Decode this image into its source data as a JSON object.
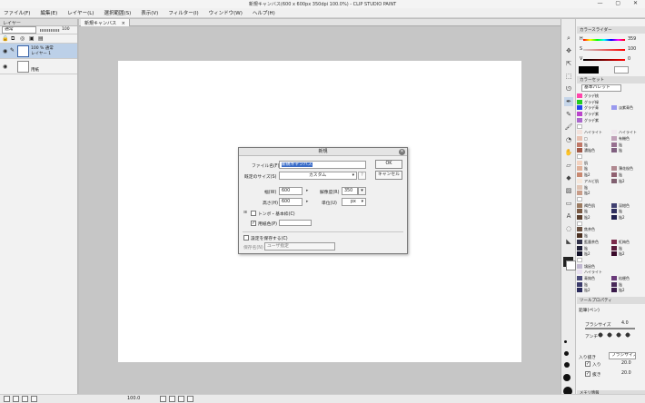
{
  "window": {
    "title": "新規キャンバス(600 x 600px 350dpi 100.0%) - CLIP STUDIO PAINT",
    "controls": "— ▢ ✕"
  },
  "menu": [
    "ファイル(F)",
    "編集(E)",
    "レイヤー(L)",
    "選択範囲(S)",
    "表示(V)",
    "フィルター(I)",
    "ウィンドウ(W)",
    "ヘルプ(H)"
  ],
  "layer_panel": {
    "title": "レイヤー",
    "blend_mode": "通常",
    "opacity": "100",
    "layers": [
      {
        "line1": "100 % 通常",
        "line2": "レイヤー 1"
      },
      {
        "line1": "",
        "line2": "用紙"
      }
    ]
  },
  "canvas": {
    "tab_label": "新規キャンバス"
  },
  "dialog": {
    "title": "新規",
    "close": "✕",
    "file_name_label": "ファイル名(F)",
    "file_name_value": "新規キャンバス",
    "preset_label": "既定のサイズ(S)",
    "preset_value": "カスタム",
    "width_label": "幅(W)",
    "width_value": "600",
    "height_label": "高さ(H)",
    "height_value": "600",
    "resolution_label": "解像度(R)",
    "resolution_value": "350",
    "unit_label": "単位(U)",
    "unit_value": "px",
    "crop_label": "トンボ・基本枠(C)",
    "paper_color_label": "用紙色(P)",
    "save_settings_label": "設定を保存する(C)",
    "save_name_label": "保存名(N)",
    "save_name_value": "ユーザ指定",
    "ok": "OK",
    "cancel": "キャンセル",
    "paper_color": "#ffffff"
  },
  "color_slider": {
    "title": "カラースライダー",
    "h_label": "H",
    "h_value": "359",
    "s_label": "S",
    "s_value": "100",
    "v_label": "V",
    "v_value": "0"
  },
  "color_set": {
    "title": "カラーセット",
    "preset": "基本パレット",
    "swatches": [
      {
        "c1": "#ff44aa",
        "l1": "グラデ桃",
        "c2": "",
        "l2": ""
      },
      {
        "c1": "#22cc22",
        "l1": "グラデ緑",
        "c2": "",
        "l2": ""
      },
      {
        "c1": "#2244ee",
        "l1": "グラデ青",
        "c2": "#9999ee",
        "l2": "淡紫青色"
      },
      {
        "c1": "#bb44cc",
        "l1": "グラデ紫",
        "c2": "",
        "l2": ""
      },
      {
        "c1": "#aa66cc",
        "l1": "グラデ紫",
        "c2": "",
        "l2": ""
      },
      {
        "c1": "#ffffff",
        "l1": "",
        "c2": "",
        "l2": ""
      },
      {
        "c1": "#f2e2dc",
        "l1": "ハイライト",
        "c2": "#f0e8ee",
        "l2": "ハイライト"
      },
      {
        "c1": "#e8c0b0",
        "l1": "□",
        "c2": "#c0a0b8",
        "l2": "有機色"
      },
      {
        "c1": "#c07868",
        "l1": "陰",
        "c2": "#987090",
        "l2": "陰"
      },
      {
        "c1": "#a05848",
        "l1": "濃陰色",
        "c2": "#806080",
        "l2": "陰"
      },
      {
        "c1": "#ffffff",
        "l1": "",
        "c2": "",
        "l2": ""
      },
      {
        "c1": "#f2d2c0",
        "l1": "肌",
        "c2": "",
        "l2": ""
      },
      {
        "c1": "#e0b098",
        "l1": "陰",
        "c2": "#b08890",
        "l2": "薄花桜色"
      },
      {
        "c1": "#c88870",
        "l1": "陰2",
        "c2": "#906070",
        "l2": "陰"
      },
      {
        "c1": "#f6e8dc",
        "l1": "アルビ肌",
        "c2": "#806070",
        "l2": "陰2"
      },
      {
        "c1": "#e0c4b4",
        "l1": "陰",
        "c2": "",
        "l2": ""
      },
      {
        "c1": "#c89c88",
        "l1": "陰2",
        "c2": "",
        "l2": ""
      },
      {
        "c1": "#ffffff",
        "l1": "",
        "c2": "",
        "l2": ""
      },
      {
        "c1": "#9a7a60",
        "l1": "褐色肌",
        "c2": "#404070",
        "l2": "深紺色"
      },
      {
        "c1": "#7a5a44",
        "l1": "陰",
        "c2": "#303060",
        "l2": "陰"
      },
      {
        "c1": "#5a3e2c",
        "l1": "陰2",
        "c2": "#202050",
        "l2": "陰2"
      },
      {
        "c1": "#ffffff",
        "l1": "",
        "c2": "",
        "l2": ""
      },
      {
        "c1": "#6a5040",
        "l1": "焦茶色",
        "c2": "",
        "l2": ""
      },
      {
        "c1": "#4a3020",
        "l1": "陰",
        "c2": "",
        "l2": ""
      },
      {
        "c1": "#303048",
        "l1": "藍墨茶色",
        "c2": "#7a2a4a",
        "l2": "紅梅色"
      },
      {
        "c1": "#202038",
        "l1": "陰",
        "c2": "#5a1a3a",
        "l2": "陰"
      },
      {
        "c1": "#101028",
        "l1": "陰2",
        "c2": "#3a0a2a",
        "l2": "陰2"
      },
      {
        "c1": "#ffffff",
        "l1": "",
        "c2": "",
        "l2": ""
      },
      {
        "c1": "#c0b8d0",
        "l1": "鴇鼠色",
        "c2": "",
        "l2": ""
      },
      {
        "c1": "#e8e0f0",
        "l1": "ハイライト",
        "c2": "",
        "l2": ""
      },
      {
        "c1": "#4a4a7a",
        "l1": "青鈍色",
        "c2": "#6a3a7a",
        "l2": "桔梗色"
      },
      {
        "c1": "#3a3a6a",
        "l1": "陰",
        "c2": "#4a2a5a",
        "l2": "陰"
      },
      {
        "c1": "#2a2a5a",
        "l1": "陰2",
        "c2": "#3a1a4a",
        "l2": "陰2"
      }
    ]
  },
  "tool_property": {
    "title": "ツールプロパティ",
    "tool_name": "鉛筆(ペン)",
    "brush_size_label": "ブラシサイズ",
    "brush_size_value": "4.0",
    "antialias_label": "アンチ",
    "in_out_label": "入り抜き",
    "in_out_value": "ブラシサイズ",
    "in_label": "入り",
    "in_value": "20.0",
    "out_label": "抜き",
    "out_value": "20.0"
  },
  "memory": {
    "title": "メモリ情報",
    "text": "システム38% アプリケーション11%"
  },
  "status": {
    "zoom": "100.0"
  }
}
